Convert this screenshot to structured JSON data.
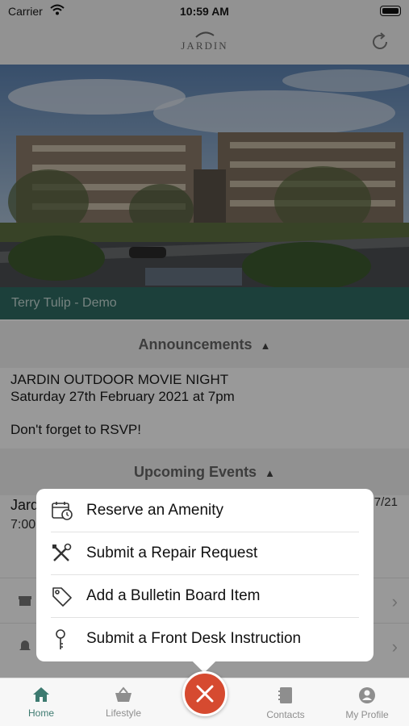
{
  "status_bar": {
    "carrier": "Carrier",
    "time": "10:59 AM"
  },
  "header": {
    "logo_text": "JARDIN"
  },
  "resident": {
    "name": "Terry Tulip - Demo"
  },
  "announcements": {
    "title": "Announcements",
    "lines": [
      "JARDIN OUTDOOR MOVIE NIGHT",
      "Saturday 27th February 2021 at 7pm",
      "Don't forget to RSVP!"
    ]
  },
  "events": {
    "title": "Upcoming Events",
    "item_title": "Jard",
    "item_time": "7:00",
    "item_date": "7/21"
  },
  "popup_menu": {
    "items": [
      {
        "label": "Reserve an Amenity",
        "icon": "calendar-clock-icon"
      },
      {
        "label": "Submit a Repair Request",
        "icon": "tools-icon"
      },
      {
        "label": "Add a Bulletin Board Item",
        "icon": "tag-icon"
      },
      {
        "label": "Submit a Front Desk Instruction",
        "icon": "key-icon"
      }
    ]
  },
  "tab_bar": {
    "tabs": [
      {
        "label": "Home",
        "icon": "home-icon",
        "active": true
      },
      {
        "label": "Lifestyle",
        "icon": "basket-icon"
      },
      {
        "label": "Contacts",
        "icon": "contacts-book-icon"
      },
      {
        "label": "My Profile",
        "icon": "profile-icon"
      }
    ],
    "center_button_icon": "close-icon"
  },
  "colors": {
    "brand_green": "#2f6b63",
    "active_tab": "#3d7a70",
    "fab_red": "#d64a30"
  }
}
